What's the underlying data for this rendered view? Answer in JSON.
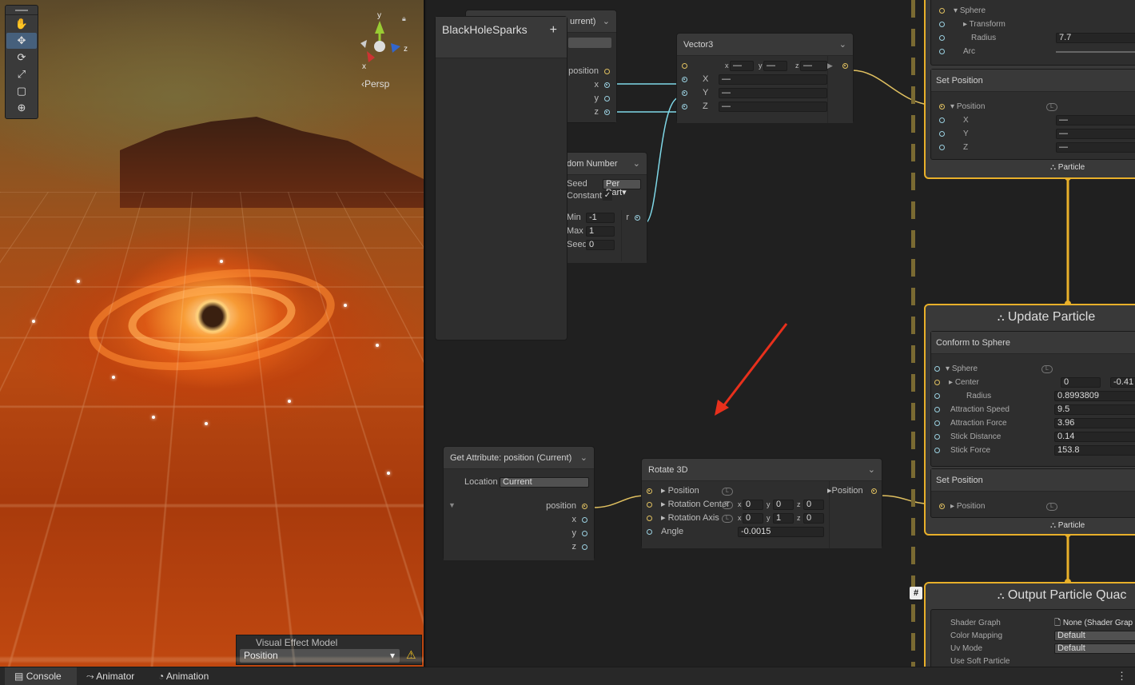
{
  "scene": {
    "persp_label": "Persp",
    "axis_x": "x",
    "axis_y": "y",
    "axis_z": "z",
    "tools": [
      "hand-icon",
      "move-icon",
      "rotate-icon",
      "scale-icon",
      "rect-icon",
      "transform-icon"
    ],
    "vem_title": "Visual Effect Model",
    "vem_value": "Position"
  },
  "graph": {
    "blackhole": {
      "title": "BlackHoleSparks",
      "add": "+"
    },
    "getattr_top": {
      "title": "urrent)",
      "port_position": "position",
      "port_x": "x",
      "port_y": "y",
      "port_z": "z"
    },
    "random": {
      "title": "dom Number",
      "seed_label": "Seed",
      "seed_mode": "Per Part▾",
      "constant_label": "Constant",
      "min_label": "Min",
      "min_value": "-1",
      "max_label": "Max",
      "max_value": "1",
      "seed2_label": "Seed",
      "seed_value": "0",
      "out": "r"
    },
    "vector3": {
      "title": "Vector3",
      "x_label": "X",
      "y_label": "Y",
      "z_label": "Z",
      "dash": "—",
      "fx": "x",
      "fy": "y",
      "fz": "z"
    },
    "getattr": {
      "title": "Get Attribute: position (Current)",
      "location_label": "Location",
      "location_value": "Current",
      "port_position": "position",
      "port_x": "x",
      "port_y": "y",
      "port_z": "z"
    },
    "rotate3d": {
      "title": "Rotate 3D",
      "position": "Position",
      "rotation_center": "Rotation Center",
      "rotation_axis": "Rotation Axis",
      "angle": "Angle",
      "center": [
        "0",
        "0",
        "0"
      ],
      "axis": [
        "0",
        "1",
        "0"
      ],
      "angle_value": "-0.0015",
      "out": "Position",
      "cx": "x",
      "cy": "y",
      "cz": "z"
    },
    "init_ctx": {
      "sphere": "Sphere",
      "transform": "Transform",
      "radius": "Radius",
      "radius_value": "7.7",
      "arc": "Arc",
      "set_position": "Set Position",
      "position": "Position",
      "x": "X",
      "y": "Y",
      "z": "Z",
      "dash": "—",
      "flow": "Particle"
    },
    "update_ctx": {
      "title": "Update Particle",
      "conform": "Conform to Sphere",
      "sphere": "Sphere",
      "center": "Center",
      "center_x": "0",
      "center_y": "-0.41",
      "radius": "Radius",
      "radius_value": "0.8993809",
      "attraction_speed": "Attraction Speed",
      "attraction_speed_value": "9.5",
      "attraction_force": "Attraction Force",
      "attraction_force_value": "3.96",
      "stick_distance": "Stick Distance",
      "stick_distance_value": "0.14",
      "stick_force": "Stick Force",
      "stick_force_value": "153.8",
      "set_position": "Set Position",
      "position": "Position",
      "flow": "Particle"
    },
    "output_ctx": {
      "title": "Output Particle Quac",
      "shader_graph": "Shader Graph",
      "shader_value": "None (Shader Grap",
      "color_mapping": "Color Mapping",
      "color_value": "Default",
      "uv_mode": "Uv Mode",
      "uv_value": "Default",
      "soft_particle": "Use Soft Particle"
    },
    "hash": "#"
  },
  "bottom": {
    "tabs": [
      "Console",
      "Animator",
      "Animation"
    ],
    "more": "⋮"
  },
  "colors": {
    "accent_yellow": "#e8b02a",
    "edge_cyan": "#7fd8e8",
    "arrow_red": "#e8301c"
  }
}
